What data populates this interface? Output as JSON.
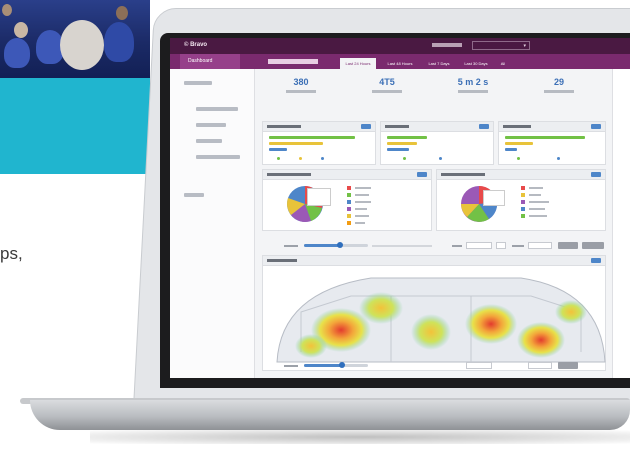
{
  "side_text": "ps,",
  "app": {
    "brand": "© Bravo",
    "dashboard_label": "Dashboard",
    "tabs": [
      {
        "label": "Last 24 Hours",
        "active": true
      },
      {
        "label": "Last 48 Hours",
        "active": false
      },
      {
        "label": "Last 7 Days",
        "active": false
      },
      {
        "label": "Last 30 Days",
        "active": false
      },
      {
        "label": "All",
        "active": false
      }
    ]
  },
  "kpis": [
    {
      "value": "380"
    },
    {
      "value": "4T5"
    },
    {
      "value": "5 m 2 s"
    },
    {
      "value": "29"
    }
  ],
  "colors": {
    "brand_purple": "#4a1942",
    "accent_purple": "#7a2a6e",
    "accent_blue": "#4e86c9",
    "cyan_panel": "#20b5cf",
    "bar_green": "#72c146",
    "bar_blue": "#4e86c9",
    "bar_yellow": "#e8c33a"
  },
  "icons": [
    "user-icon",
    "chevron-down-icon",
    "pie-chart-icon",
    "heatmap-icon",
    "slider-knob-icon"
  ]
}
